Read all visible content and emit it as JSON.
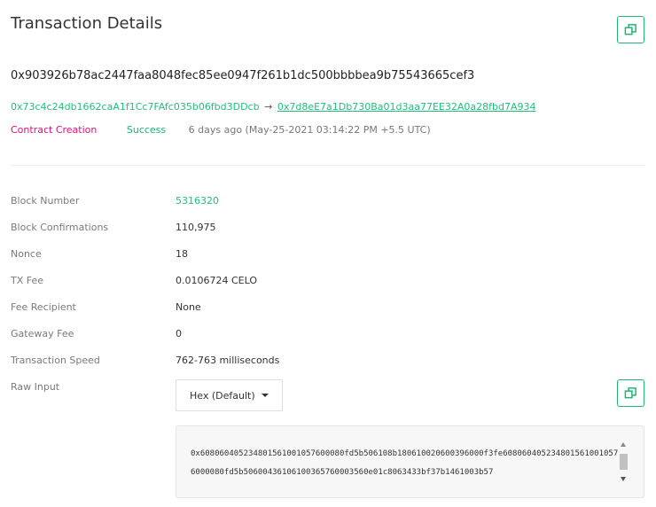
{
  "header": {
    "title": "Transaction Details"
  },
  "tx": {
    "hash": "0x903926b78ac2447faa8048fec85ee0947f261b1dc500bbbbea9b75543665cef3",
    "from": "0x73c4c24db1662caA1f1Cc7FAfc035b06fbd3DDcb",
    "arrow": "→",
    "to": "0x7d8eE7a1Db730Ba01d3aa77EE32A0a28fbd7A934",
    "type": "Contract Creation",
    "status": "Success",
    "time": "6 days ago (May-25-2021 03:14:22 PM +5.5 UTC)"
  },
  "details": [
    {
      "label": "Block Number",
      "value": "5316320"
    },
    {
      "label": "Block Confirmations",
      "value": "110,975"
    },
    {
      "label": "Nonce",
      "value": "18"
    },
    {
      "label": "TX Fee",
      "value": "0.0106724 CELO"
    },
    {
      "label": "Fee Recipient",
      "value": "None"
    },
    {
      "label": "Gateway Fee",
      "value": "0"
    },
    {
      "label": "Transaction Speed",
      "value": "762-763 milliseconds"
    },
    {
      "label": "Raw Input",
      "value": ""
    }
  ],
  "raw_input": {
    "format_selected": "Hex (Default)",
    "data": "0x608060405234801561001057600080fd5b506108b180610020600396000f3fe6080604052348015610010576000080fd5b50600436106100365760003560e01c8063433bf37b1461003b57"
  },
  "colors": {
    "accent": "#20c07a",
    "contract": "#e0117a",
    "success": "#20b575"
  },
  "icons": {
    "copy": "copy-icon",
    "caret": "caret-down-icon"
  }
}
